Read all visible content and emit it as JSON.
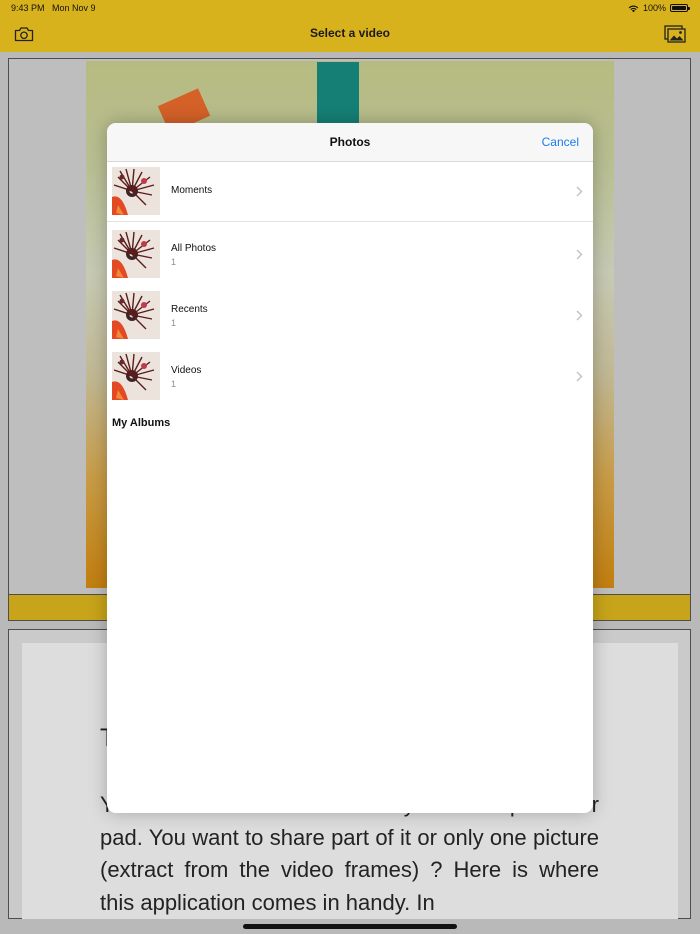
{
  "status_bar": {
    "time": "9:43 PM",
    "date": "Mon Nov 9",
    "battery": "100%"
  },
  "nav": {
    "title": "Select a video",
    "left_icon": "camera-icon",
    "right_icon": "photo-gallery-icon"
  },
  "photos_sheet": {
    "title": "Photos",
    "cancel_label": "Cancel",
    "albums": [
      {
        "name": "Moments",
        "count": ""
      },
      {
        "name": "All Photos",
        "count": "1"
      },
      {
        "name": "Recents",
        "count": "1"
      },
      {
        "name": "Videos",
        "count": "1"
      }
    ],
    "section_title": "My Albums"
  },
  "document": {
    "heading": "T",
    "body": "You recorded a nice video on your smartphone or pad. You want to share part of it or only one picture (extract from the video frames) ? Here is where this application comes in handy. In"
  },
  "colors": {
    "accent_bar": "#d8b21d",
    "link": "#1a7cf0"
  }
}
